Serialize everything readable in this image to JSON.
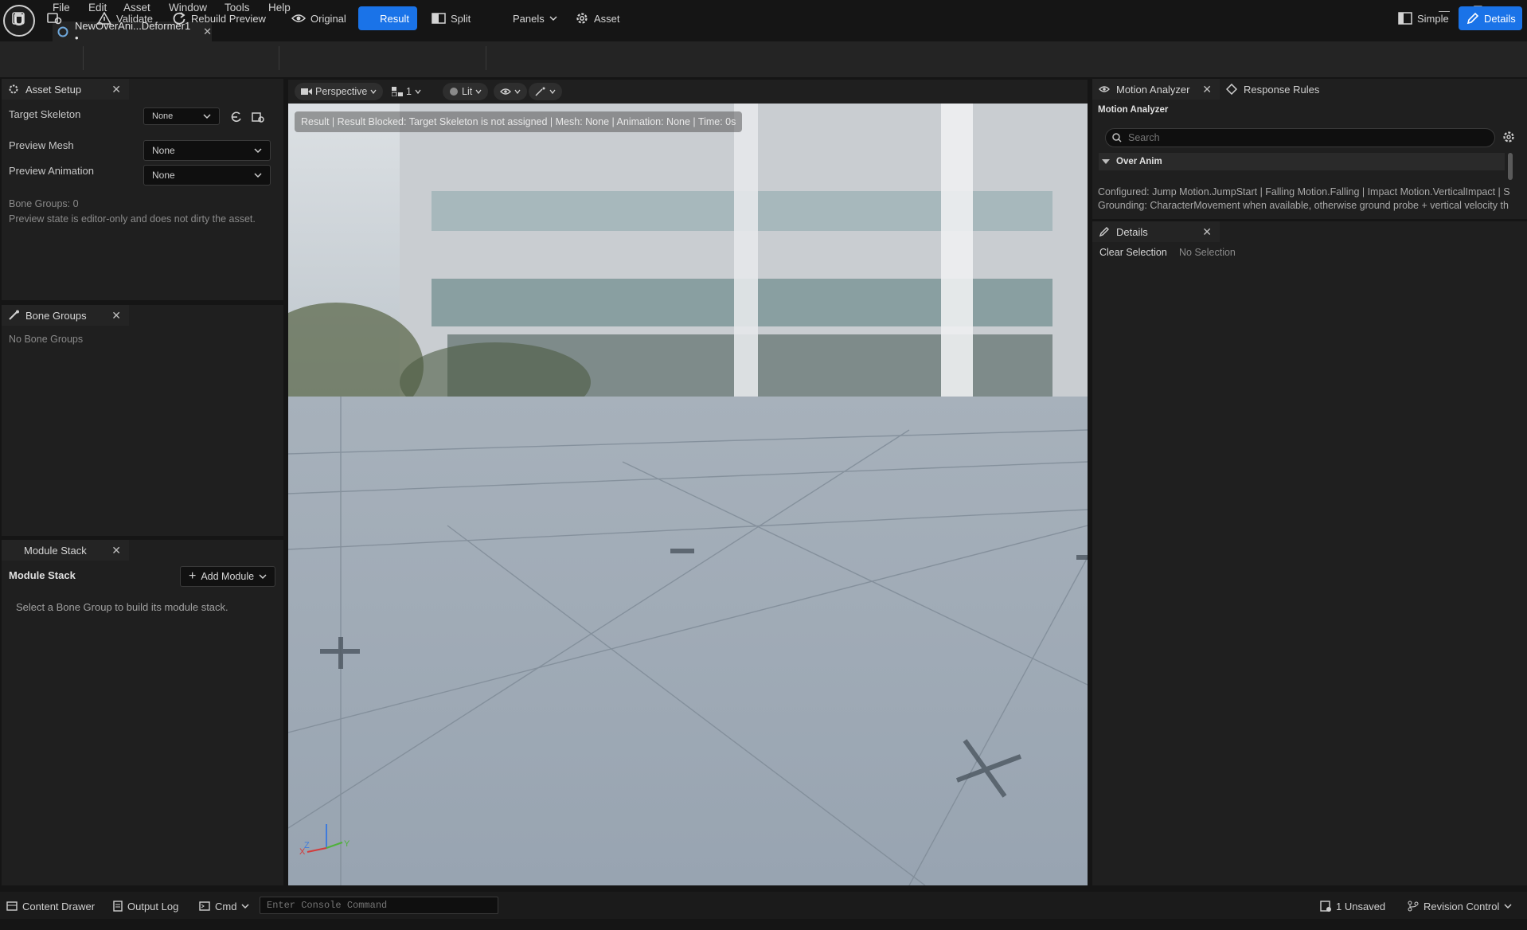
{
  "app": {
    "logo_text": "U",
    "menu": [
      "File",
      "Edit",
      "Asset",
      "Window",
      "Tools",
      "Help"
    ],
    "document_tab": "NewOverAni...Deformer1 •",
    "window_controls": [
      "minimize-icon",
      "restore-icon",
      "close-icon"
    ]
  },
  "toolbar": {
    "validate": "Validate",
    "rebuild": "Rebuild Preview",
    "original": "Original",
    "result": "Result",
    "split": "Split",
    "panels": "Panels",
    "asset": "Asset",
    "simple": "Simple",
    "details": "Details",
    "active_color": "#1a73e8"
  },
  "asset_setup": {
    "title": "Asset Setup",
    "target_skeleton_label": "Target Skeleton",
    "target_skeleton_value": "None",
    "preview_mesh_label": "Preview Mesh",
    "preview_mesh_value": "None",
    "preview_animation_label": "Preview Animation",
    "preview_animation_value": "None",
    "bone_groups_count": "Bone Groups: 0",
    "note": "Preview state is editor-only and does not dirty the asset."
  },
  "bone_groups": {
    "title": "Bone Groups",
    "empty": "No Bone Groups"
  },
  "module_stack": {
    "tab": "Module Stack",
    "heading": "Module Stack",
    "add_module": "Add Module",
    "hint": "Select a Bone Group to build its module stack."
  },
  "viewport": {
    "perspective": "Perspective",
    "layout_count": "1",
    "lit": "Lit",
    "status": "Result | Result Blocked: Target Skeleton is not assigned | Mesh: None | Animation: None | Time: 0s",
    "axis_x": "X",
    "axis_y": "Y",
    "axis_z": "Z"
  },
  "motion_analyzer": {
    "tab": "Motion Analyzer",
    "tab2": "Response Rules",
    "heading": "Motion Analyzer",
    "search_placeholder": "Search",
    "section": "Over Anim",
    "line1": "Configured: Jump Motion.JumpStart | Falling Motion.Falling | Impact Motion.VerticalImpact | S",
    "line2": "Grounding: CharacterMovement when available, otherwise ground probe + vertical velocity th"
  },
  "details": {
    "tab": "Details",
    "clear_selection": "Clear Selection",
    "no_selection": "No Selection"
  },
  "statusbar": {
    "content_drawer": "Content Drawer",
    "output_log": "Output Log",
    "cmd": "Cmd",
    "console_placeholder": "Enter Console Command",
    "unsaved": "1 Unsaved",
    "revision_control": "Revision Control"
  }
}
